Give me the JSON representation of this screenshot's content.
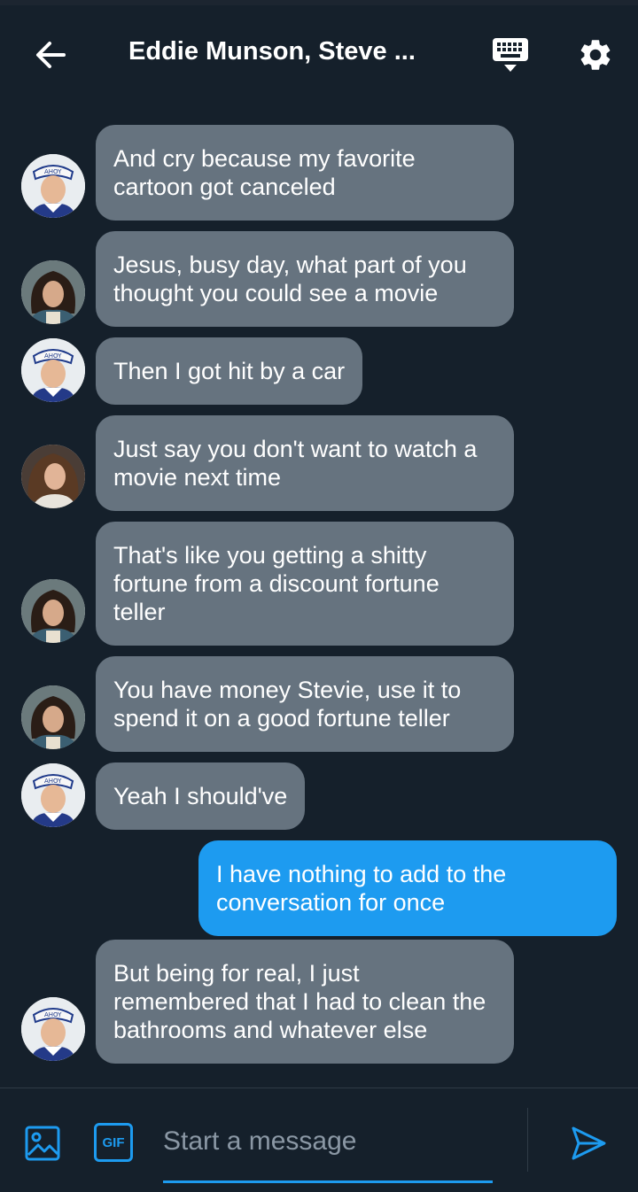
{
  "header": {
    "title": "Eddie Munson, Steve ...",
    "back_icon": "arrow-left-icon",
    "keyboard_icon": "keyboard-icon",
    "settings_icon": "gear-icon"
  },
  "messages": [
    {
      "sender": "steve",
      "direction": "in",
      "text": "And cry because my favorite cartoon got canceled"
    },
    {
      "sender": "eddie",
      "direction": "in",
      "text": "Jesus, busy day, what part of you thought you could see a movie"
    },
    {
      "sender": "steve",
      "direction": "in",
      "text": "Then I got hit by a car"
    },
    {
      "sender": "robin",
      "direction": "in",
      "text": "Just say you don't want to watch a movie next time"
    },
    {
      "sender": "eddie",
      "direction": "in",
      "text": "That's like you getting a shitty fortune from a discount fortune teller"
    },
    {
      "sender": "eddie",
      "direction": "in",
      "text": "You have money Stevie, use it to spend it on a good fortune teller"
    },
    {
      "sender": "steve",
      "direction": "in",
      "text": "Yeah I should've"
    },
    {
      "sender": "me",
      "direction": "out",
      "text": "I have nothing to add to the conversation for once"
    },
    {
      "sender": "steve",
      "direction": "in",
      "text": "But being for real, I just remembered that I had to clean the bathrooms and whatever else"
    }
  ],
  "composer": {
    "placeholder": "Start a message",
    "gif_label": "GIF",
    "image_icon": "image-icon",
    "send_icon": "send-icon"
  },
  "colors": {
    "background": "#15202b",
    "incoming_bubble": "#66737f",
    "outgoing_bubble": "#1d9bf0",
    "accent": "#1d9bf0"
  }
}
